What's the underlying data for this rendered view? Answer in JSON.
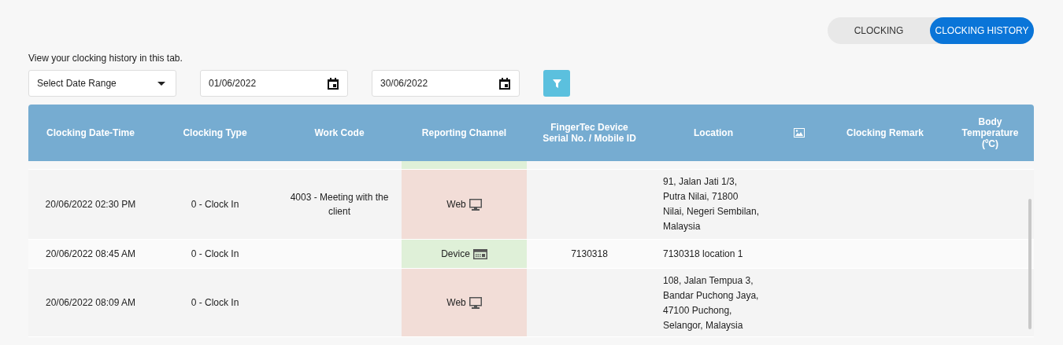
{
  "tabs": [
    {
      "label": "CLOCKING",
      "selected": false
    },
    {
      "label": "CLOCKING HISTORY",
      "selected": true
    }
  ],
  "intro": "View your clocking history in this tab.",
  "filters": {
    "range": "Select Date Range",
    "start": "01/06/2022",
    "end": "30/06/2022"
  },
  "table": {
    "columns": [
      {
        "label": "Clocking Date-Time",
        "kind": "text"
      },
      {
        "label": "Clocking Type",
        "kind": "text"
      },
      {
        "label": "Work Code",
        "kind": "text"
      },
      {
        "label": "Reporting Channel",
        "kind": "text"
      },
      {
        "label": "FingerTec Device Serial No. / Mobile ID",
        "kind": "text"
      },
      {
        "label": "Location",
        "kind": "text"
      },
      {
        "kind": "image"
      },
      {
        "label": "Clocking Remark",
        "kind": "text"
      },
      {
        "label": "Body Temperature (ºC)",
        "kind": "text"
      }
    ],
    "clipped_row": {
      "kind": "device"
    },
    "rows": [
      {
        "datetime": "20/06/2022 02:30 PM",
        "type": "0 - Clock In",
        "work_code": "4003 - Meeting with the client",
        "channel": "Web",
        "kind": "web",
        "location": [
          "91, Jalan Jati 1/3,",
          "Putra Nilai, 71800",
          "Nilai, Negeri Sembilan,",
          "Malaysia"
        ]
      },
      {
        "datetime": "20/06/2022 08:45 AM",
        "type": "0 - Clock In",
        "channel": "Device",
        "kind": "device",
        "serial": "7130318",
        "location": [
          "7130318 location 1"
        ]
      },
      {
        "datetime": "20/06/2022 08:09 AM",
        "type": "0 - Clock In",
        "channel": "Web",
        "kind": "web",
        "location": [
          "108, Jalan Tempua 3,",
          "Bandar Puchong Jaya,",
          "47100 Puchong,",
          "Selangor, Malaysia"
        ]
      }
    ]
  }
}
